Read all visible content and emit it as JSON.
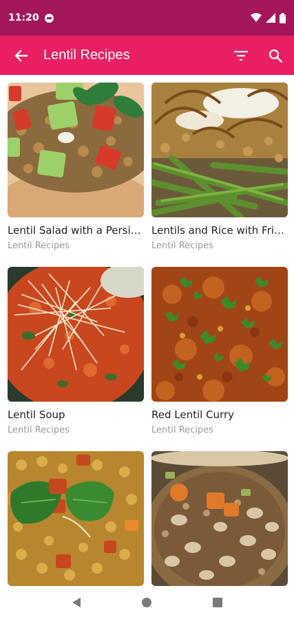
{
  "status_bar": {
    "time": "11:20",
    "icons": [
      "dnd-icon",
      "wifi-icon",
      "signal-icon",
      "battery-icon"
    ]
  },
  "app_bar": {
    "title": "Lentil Recipes",
    "back_icon": "arrow-back-icon",
    "filter_icon": "filter-icon",
    "search_icon": "search-icon",
    "background": "#ea1e63"
  },
  "recipes": [
    {
      "name": "Lentil Salad with a Persian Twist",
      "category": "Lentil Recipes"
    },
    {
      "name": "Lentils and Rice with Fried Onions",
      "category": "Lentil Recipes"
    },
    {
      "name": "Lentil Soup",
      "category": "Lentil Recipes"
    },
    {
      "name": "Red Lentil Curry",
      "category": "Lentil Recipes"
    },
    {
      "name": "",
      "category": ""
    },
    {
      "name": "",
      "category": ""
    }
  ],
  "nav_bar": {
    "icons": [
      "back-triangle-icon",
      "home-circle-icon",
      "recents-square-icon"
    ]
  },
  "colors": {
    "status_bar": "#a3175a",
    "app_bar": "#ea1e63",
    "text_primary": "#222222",
    "text_secondary": "#9a9a9a"
  }
}
